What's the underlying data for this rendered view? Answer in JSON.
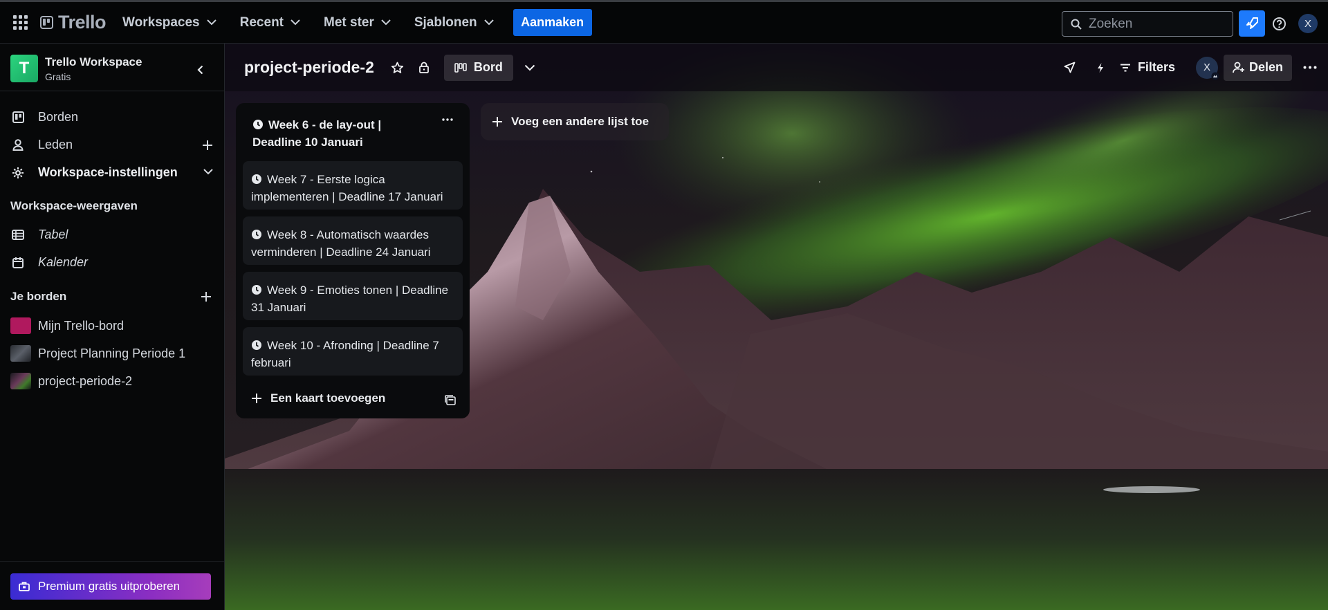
{
  "topbar": {
    "logo": "Trello",
    "nav": [
      {
        "label": "Workspaces"
      },
      {
        "label": "Recent"
      },
      {
        "label": "Met ster"
      },
      {
        "label": "Sjablonen"
      }
    ],
    "create_label": "Aanmaken",
    "search_placeholder": "Zoeken",
    "avatar_initial": "X"
  },
  "sidebar": {
    "workspace_initial": "T",
    "workspace_name": "Trello Workspace",
    "workspace_plan": "Gratis",
    "items": [
      {
        "label": "Borden",
        "icon": "board-icon"
      },
      {
        "label": "Leden",
        "icon": "person-icon"
      },
      {
        "label": "Workspace-instellingen",
        "icon": "gear-icon"
      }
    ],
    "views_heading": "Workspace-weergaven",
    "views": [
      {
        "label": "Tabel",
        "icon": "table-icon"
      },
      {
        "label": "Kalender",
        "icon": "calendar-icon"
      }
    ],
    "boards_heading": "Je borden",
    "boards": [
      {
        "label": "Mijn Trello-bord",
        "color": "#b0195e"
      },
      {
        "label": "Project Planning Periode 1",
        "color": "#3a3f47"
      },
      {
        "label": "project-periode-2",
        "color": "#2c3a26"
      }
    ],
    "premium_label": "Premium gratis uitproberen"
  },
  "board": {
    "title": "project-periode-2",
    "view_label": "Bord",
    "filters_label": "Filters",
    "member_initial": "X",
    "share_label": "Delen",
    "list": {
      "title": "Week 6 - de lay-out | Deadline 10 Januari",
      "cards": [
        {
          "title": "Week 7 - Eerste logica implementeren | Deadline 17 Januari"
        },
        {
          "title": "Week 8 - Automatisch waardes verminderen | Deadline 24 Januari"
        },
        {
          "title": "Week 9 - Emoties tonen | Deadline 31 Januari"
        },
        {
          "title": "Week 10 - Afronding | Deadline 7 februari"
        }
      ],
      "add_card_label": "Een kaart toevoegen"
    },
    "add_list_label": "Voeg een andere lijst toe"
  },
  "colors": {
    "accent": "#0c66e4",
    "rocket": "#1d7afc",
    "workspace_avatar": "#22c46f"
  }
}
